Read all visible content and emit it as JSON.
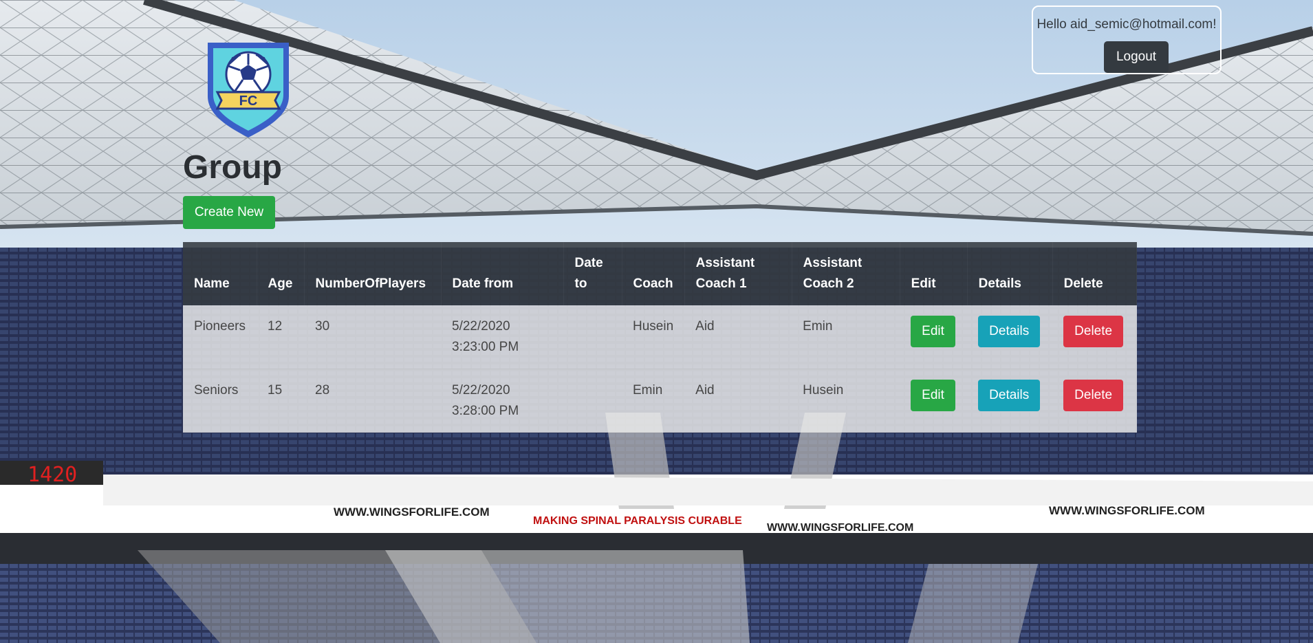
{
  "header": {
    "greeting": "Hello aid_semic@hotmail.com!",
    "logout_label": "Logout"
  },
  "logo": {
    "badge_text": "FC"
  },
  "page": {
    "title": "Group",
    "create_label": "Create New"
  },
  "table": {
    "headers": [
      "Name",
      "Age",
      "NumberOfPlayers",
      "Date from",
      "Date to",
      "Coach",
      "Assistant Coach 1",
      "Assistant Coach 2",
      "Edit",
      "Details",
      "Delete"
    ],
    "rows": [
      {
        "name": "Pioneers",
        "age": "12",
        "players": "30",
        "date_from": "5/22/2020 3:23:00 PM",
        "date_to": "",
        "coach": "Husein",
        "assistant1": "Aid",
        "assistant2": "Emin",
        "edit": "Edit",
        "details": "Details",
        "delete": "Delete"
      },
      {
        "name": "Seniors",
        "age": "15",
        "players": "28",
        "date_from": "5/22/2020 3:28:00 PM",
        "date_to": "",
        "coach": "Emin",
        "assistant1": "Aid",
        "assistant2": "Husein",
        "edit": "Edit",
        "details": "Details",
        "delete": "Delete"
      }
    ]
  },
  "background": {
    "scoreboard": "1420",
    "banners": [
      "WWW.WINGSFORLIFE.COM",
      "MAKING SPINAL PARALYSIS CURABLE",
      "WWW.WINGSFORLIFE.COM",
      "WWW.WINGSFORLIFE.COM"
    ]
  },
  "colors": {
    "primary_dark": "#343a40",
    "success": "#28a745",
    "info": "#17a2b8",
    "danger": "#dc3545"
  }
}
